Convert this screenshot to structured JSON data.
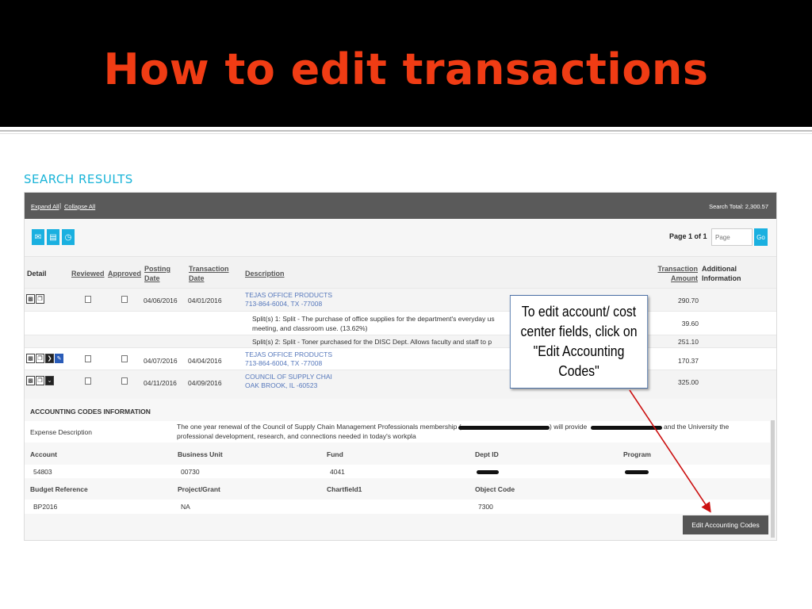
{
  "slide": {
    "title": "How to edit transactions"
  },
  "search": {
    "title": "SEARCH RESULTS",
    "expand_all": "Expand All",
    "separator": "|",
    "collapse_all": "Collapse All",
    "search_total": "Search Total: 2,300.57",
    "page_info": "Page 1 of 1",
    "page_placeholder": "Page",
    "go_label": "Go"
  },
  "toolbar_icons": [
    "email-icon",
    "save-icon",
    "history-icon"
  ],
  "columns": {
    "detail": "Detail",
    "reviewed": "Reviewed",
    "approved": "Approved",
    "posting_date_1": "Posting",
    "posting_date_2": "Date",
    "transaction_date_1": "Transaction",
    "transaction_date_2": "Date",
    "description": "Description",
    "transaction_amount_1": "Transaction",
    "transaction_amount_2": "Amount",
    "additional_info_1": "Additional",
    "additional_info_2": "Information"
  },
  "rows": [
    {
      "posting": "04/06/2016",
      "transaction": "04/01/2016",
      "vendor": "TEJAS OFFICE PRODUCTS",
      "location": "713-864-6004, TX -77008",
      "amount": "290.70"
    },
    {
      "posting": "04/07/2016",
      "transaction": "04/04/2016",
      "vendor": "TEJAS OFFICE PRODUCTS",
      "location": "713-864-6004, TX -77008",
      "amount": "170.37"
    },
    {
      "posting": "04/11/2016",
      "transaction": "04/09/2016",
      "vendor": "COUNCIL OF SUPPLY CHAI",
      "location": "OAK BROOK, IL -60523",
      "amount": "325.00"
    }
  ],
  "splits": [
    {
      "text": "Split(s) 1:  Split - The purchase of office supplies for the department's everyday us",
      "text2": "meeting, and classroom use. (13.62%)",
      "amount": "39.60"
    },
    {
      "text": "Split(s) 2:  Split - Toner purchased for the DISC Dept. Allows faculty and staff to p",
      "amount": "251.10"
    }
  ],
  "accounting": {
    "title": "ACCOUNTING CODES INFORMATION",
    "expense_label": "Expense Description",
    "expense_text_1a": "The one year renewal of the Council of Supply Chain Management Professionals membership (",
    "expense_text_1b": ") will provide",
    "expense_text_1c": "and the University the",
    "expense_text_2": "professional development, research, and connections needed in today's workpla",
    "labels": {
      "account": "Account",
      "business_unit": "Business Unit",
      "fund": "Fund",
      "dept_id": "Dept ID",
      "program": "Program",
      "budget_reference": "Budget Reference",
      "project_grant": "Project/Grant",
      "chartfield1": "Chartfield1",
      "object_code": "Object Code"
    },
    "values": {
      "account": "54803",
      "business_unit": "00730",
      "fund": "4041",
      "budget_reference": "BP2016",
      "project_grant": "NA",
      "object_code": "7300"
    },
    "edit_button": "Edit Accounting Codes"
  },
  "callout": {
    "line1": "To edit account/ cost",
    "line2": "center fields, click on",
    "line3": "\"Edit Accounting Codes\""
  },
  "colors": {
    "title_red": "#f03c14",
    "accent_blue": "#1ab0e0",
    "link_blue": "#5577bb",
    "arrow_red": "#cc1111"
  }
}
